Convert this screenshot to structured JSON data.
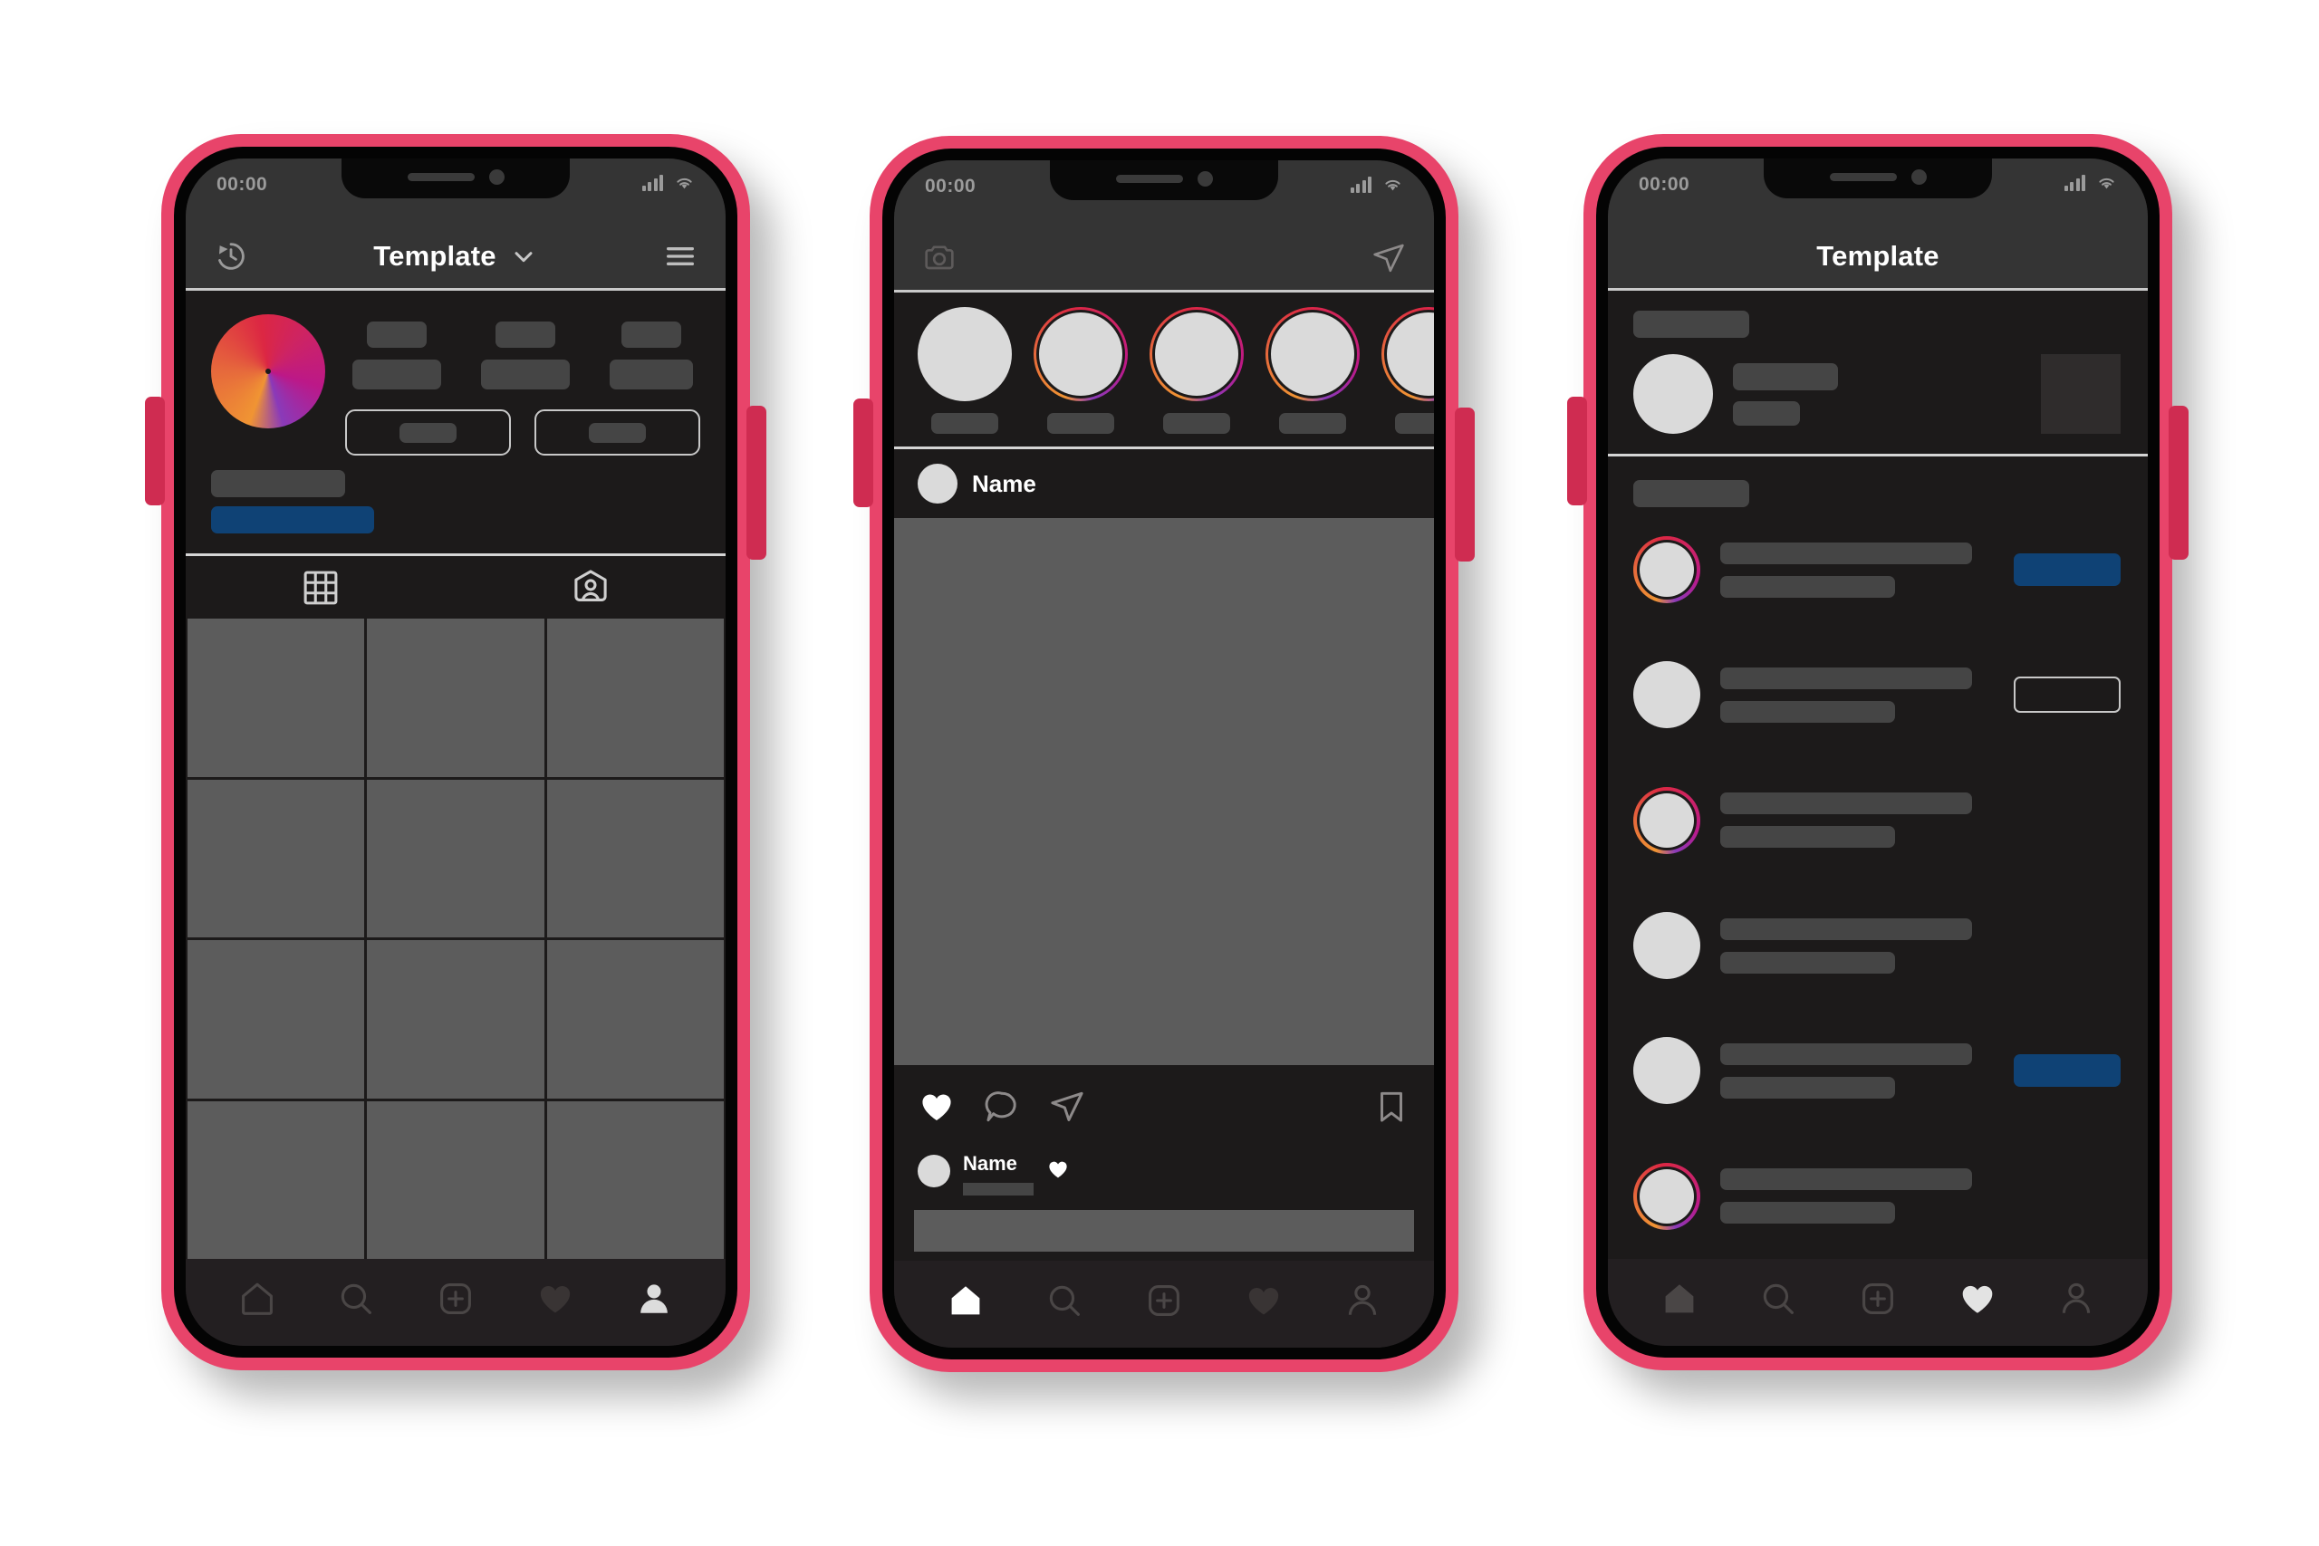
{
  "meta": {
    "background": "#ffffff",
    "frame_color": "#e8446a",
    "frame_button_color": "#cf2c51",
    "screen_bg": "#1c1a1a",
    "statusbar_bg": "#343434",
    "skeleton_gray": "#454545",
    "placeholder_gray": "#5c5c5c",
    "avatar_gray": "#dadada",
    "accent_blue": "#0f4275",
    "divider": "#d5d5d5",
    "story_ring_gradient": "#f09433 #dc2743 #bc1888 #8a3ab9"
  },
  "phones": [
    {
      "id": "profile",
      "statusbar": {
        "time": "00:00",
        "signal_icon": "cellular-bars-icon",
        "wifi_icon": "wifi-icon"
      },
      "appbar": {
        "left_icon": "history-clock-icon",
        "title": "Template",
        "chevron_icon": "chevron-down-icon",
        "right_icon": "hamburger-menu-icon"
      },
      "profile": {
        "avatar": "profile-avatar",
        "stats": [
          {
            "count_placeholder": "",
            "label_placeholder": ""
          },
          {
            "count_placeholder": "",
            "label_placeholder": ""
          },
          {
            "count_placeholder": "",
            "label_placeholder": ""
          }
        ],
        "buttons": [
          {
            "name": "edit-profile-button",
            "label_placeholder": ""
          },
          {
            "name": "share-profile-button",
            "label_placeholder": ""
          }
        ],
        "bio_lines": [
          {
            "name": "bio-name-placeholder",
            "color": "#454545"
          },
          {
            "name": "bio-link-placeholder",
            "color": "#0f4275"
          }
        ]
      },
      "tabs": [
        {
          "name": "tab-grid",
          "icon": "grid-icon",
          "active": true
        },
        {
          "name": "tab-tagged",
          "icon": "tagged-person-icon",
          "active": false
        }
      ],
      "grid": {
        "columns": 3,
        "rows": 4,
        "cells": 12
      },
      "bottom_nav": [
        {
          "name": "nav-home",
          "icon": "home-icon",
          "active": false
        },
        {
          "name": "nav-search",
          "icon": "search-icon",
          "active": false
        },
        {
          "name": "nav-create",
          "icon": "plus-square-icon",
          "active": false
        },
        {
          "name": "nav-activity",
          "icon": "heart-icon",
          "active": false
        },
        {
          "name": "nav-profile",
          "icon": "person-icon",
          "active": true
        }
      ]
    },
    {
      "id": "feed",
      "statusbar": {
        "time": "00:00",
        "signal_icon": "cellular-bars-icon",
        "wifi_icon": "wifi-icon"
      },
      "appbar": {
        "left_icon": "camera-icon",
        "title": "",
        "right_icon": "direct-message-icon"
      },
      "stories": [
        {
          "name": "story-own",
          "ring": false
        },
        {
          "name": "story-1",
          "ring": true
        },
        {
          "name": "story-2",
          "ring": true
        },
        {
          "name": "story-3",
          "ring": true
        },
        {
          "name": "story-4",
          "ring": true
        }
      ],
      "post": {
        "author": "Name",
        "image_placeholder": "post-image",
        "actions": [
          {
            "name": "like-button",
            "icon": "heart-filled-icon"
          },
          {
            "name": "comment-button",
            "icon": "comment-bubble-icon"
          },
          {
            "name": "share-button",
            "icon": "direct-message-icon"
          },
          {
            "name": "save-button",
            "icon": "bookmark-icon"
          }
        ],
        "comment": {
          "author": "Name",
          "text_placeholder": "",
          "like_icon": "heart-filled-icon"
        }
      },
      "compose_placeholder": "add-comment-bar",
      "bottom_nav": [
        {
          "name": "nav-home",
          "icon": "home-icon",
          "active": true
        },
        {
          "name": "nav-search",
          "icon": "search-icon",
          "active": false
        },
        {
          "name": "nav-create",
          "icon": "plus-square-icon",
          "active": false
        },
        {
          "name": "nav-activity",
          "icon": "heart-icon",
          "active": false
        },
        {
          "name": "nav-profile",
          "icon": "person-icon",
          "active": false
        }
      ]
    },
    {
      "id": "activity",
      "statusbar": {
        "time": "00:00",
        "signal_icon": "cellular-bars-icon",
        "wifi_icon": "wifi-icon"
      },
      "appbar": {
        "title": "Template"
      },
      "section_label_placeholder": "today-section-label",
      "featured": {
        "avatar": "featured-avatar",
        "line1_placeholder": "",
        "line2_placeholder": "",
        "thumbnail": "post-thumbnail"
      },
      "list_label_placeholder": "this-week-section-label",
      "rows": [
        {
          "name": "activity-row-1",
          "ring": true,
          "button": "filled"
        },
        {
          "name": "activity-row-2",
          "ring": false,
          "button": "outline"
        },
        {
          "name": "activity-row-3",
          "ring": true,
          "button": "none"
        },
        {
          "name": "activity-row-4",
          "ring": false,
          "button": "none"
        },
        {
          "name": "activity-row-5",
          "ring": false,
          "button": "filled"
        },
        {
          "name": "activity-row-6",
          "ring": true,
          "button": "none"
        }
      ],
      "bottom_nav": [
        {
          "name": "nav-home",
          "icon": "home-icon",
          "active": false
        },
        {
          "name": "nav-search",
          "icon": "search-icon",
          "active": false
        },
        {
          "name": "nav-create",
          "icon": "plus-square-icon",
          "active": false
        },
        {
          "name": "nav-activity",
          "icon": "heart-filled-icon",
          "active": true
        },
        {
          "name": "nav-profile",
          "icon": "person-icon",
          "active": false
        }
      ]
    }
  ]
}
